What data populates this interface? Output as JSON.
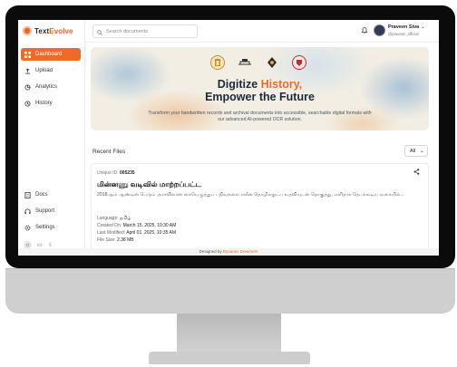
{
  "app": {
    "logo_prefix": "Text",
    "logo_suffix": "Evolve"
  },
  "sidebar": {
    "items": [
      {
        "label": "Dashboard",
        "icon": "grid-icon"
      },
      {
        "label": "Upload",
        "icon": "upload-icon"
      },
      {
        "label": "Analytics",
        "icon": "analytics-icon"
      },
      {
        "label": "History",
        "icon": "history-icon"
      }
    ],
    "bottom": [
      {
        "label": "Docs",
        "icon": "docs-icon"
      },
      {
        "label": "Support",
        "icon": "headset-icon"
      },
      {
        "label": "Settings",
        "icon": "gear-icon"
      }
    ]
  },
  "header": {
    "search_placeholder": "Search documents",
    "user_name": "Praveen Siva",
    "user_handle": "@praveen_official"
  },
  "banner": {
    "title_1": "Digitize ",
    "title_highlight": "History,",
    "title_2": "Empower the Future",
    "subtitle": "Transform your handwritten records and archival documents into accessible, searchable digital formats with our advanced AI-powered OCR solution."
  },
  "recent": {
    "label": "Recent Files",
    "filter_value": "All"
  },
  "file": {
    "uid_label": "Unique ID:",
    "uid_value": "005235",
    "title": "மின்னணு வடிவில் மாற்றப்பட்ட",
    "description": "2018ஆம் ஆண்டின் பெரும் அளவிலான கையெழுத்துப் பதிவுகளை நவீன தொழில்நுட்ப உதவியுடன் தொகுத்து, எளிதாக தேடக்கூடிய வகையில்...",
    "language_label": "Language:",
    "language_value": "தமிழ்",
    "created_label": "Created On:",
    "created_value": "March 15, 2025, 10:30 AM",
    "modified_label": "Last Modified:",
    "modified_value": "April 01, 2025, 10:35 AM",
    "size_label": "File Size:",
    "size_value": "2.38 MB"
  },
  "footer": {
    "prefix": "Designed by ",
    "brand": "Dynamic Dreamers"
  },
  "colors": {
    "accent": "#ee6a28",
    "title": "#1e2a3a"
  }
}
